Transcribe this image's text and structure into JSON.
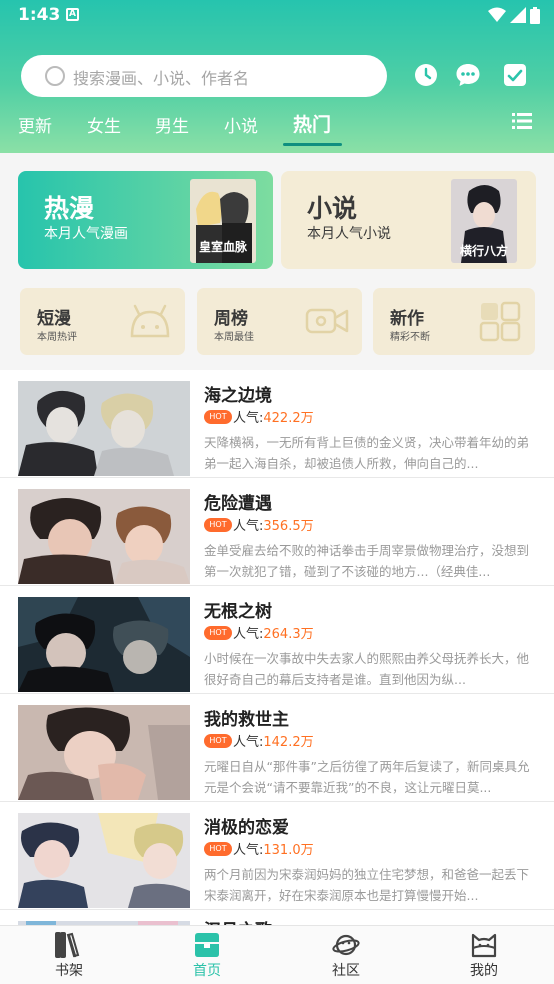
{
  "status": {
    "time": "1:43",
    "badge": "A"
  },
  "search": {
    "placeholder": "搜索漫画、小说、作者名"
  },
  "header_icons": [
    "history-clock-icon",
    "message-bubble-icon",
    "checklist-icon"
  ],
  "tabs": [
    {
      "label": "更新"
    },
    {
      "label": "女生"
    },
    {
      "label": "男生"
    },
    {
      "label": "小说"
    },
    {
      "label": "热门",
      "active": true
    }
  ],
  "featured": [
    {
      "title": "热漫",
      "subtitle": "本月人气漫画",
      "cover_text": "皇室血脉"
    },
    {
      "title": "小说",
      "subtitle": "本月人气小说",
      "cover_text": "横行八方"
    }
  ],
  "categories": [
    {
      "title": "短漫",
      "subtitle": "本周热评",
      "icon": "android-face-icon"
    },
    {
      "title": "周榜",
      "subtitle": "本周最佳",
      "icon": "video-camera-icon"
    },
    {
      "title": "新作",
      "subtitle": "精彩不断",
      "icon": "grid-squares-icon"
    }
  ],
  "hot_badge": "HOT",
  "popularity_label": "人气:",
  "items": [
    {
      "title": "海之边境",
      "popularity": "422.2万",
      "desc": "天降横祸，一无所有背上巨债的金义贤，决心带着年幼的弟弟一起入海自杀，却被追债人所救，伸向自己的..."
    },
    {
      "title": "危险遭遇",
      "popularity": "356.5万",
      "desc": "金单受雇去给不败的神话拳击手周宰景做物理治疗，没想到第一次就犯了错，碰到了不该碰的地方...（经典佳..."
    },
    {
      "title": "无根之树",
      "popularity": "264.3万",
      "desc": "小时候在一次事故中失去家人的熙熙由养父母抚养长大，他很好奇自己的幕后支持者是谁。直到他因为纵..."
    },
    {
      "title": "我的救世主",
      "popularity": "142.2万",
      "desc": "元曜日自从“那件事”之后彷徨了两年后复读了，新同桌具允元是个会说“请不要靠近我”的不良，这让元曜日莫..."
    },
    {
      "title": "消极的恋爱",
      "popularity": "131.0万",
      "desc": "两个月前因为宋泰润妈妈的独立住宅梦想，和爸爸一起丢下宋泰润离开，好在宋泰润原本也是打算慢慢开始..."
    }
  ],
  "partial_item_title": "汉月之歌",
  "bottom_nav": [
    {
      "label": "书架",
      "icon": "bookshelf-icon"
    },
    {
      "label": "首页",
      "icon": "home-icon",
      "active": true
    },
    {
      "label": "社区",
      "icon": "planet-icon"
    },
    {
      "label": "我的",
      "icon": "cat-face-icon"
    }
  ],
  "colors": {
    "accent": "#2bc2a9",
    "hot_orange": "#ff6b2d",
    "card_beige": "#f4ecd6"
  }
}
